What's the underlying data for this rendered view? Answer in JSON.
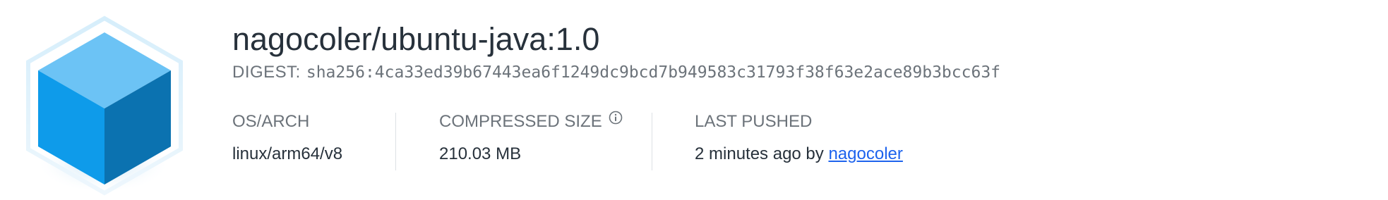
{
  "image": {
    "name": "nagocoler/ubuntu-java:1.0",
    "icon": "cube-icon",
    "colors": {
      "cube_top": "#6cc3f5",
      "cube_left": "#0e9bea",
      "cube_right": "#0b72b0",
      "hexagon_outline": "#bfe3f8"
    }
  },
  "digest": {
    "label": "DIGEST:",
    "value": "sha256:4ca33ed39b67443ea6f1249dc9bcd7b949583c31793f38f63e2ace89b3bcc63f"
  },
  "details": {
    "os_arch": {
      "label": "OS/ARCH",
      "value": "linux/arm64/v8"
    },
    "compressed_size": {
      "label": "COMPRESSED SIZE",
      "value": "210.03 MB",
      "info_icon": "info-circle-icon"
    },
    "last_pushed": {
      "label": "LAST PUSHED",
      "value_prefix": "2 minutes ago by",
      "user": "nagocoler"
    }
  },
  "colors": {
    "link": "#1d63ed",
    "label_text": "#6c737a",
    "primary_text": "#27313b",
    "divider": "#dde1e5"
  }
}
